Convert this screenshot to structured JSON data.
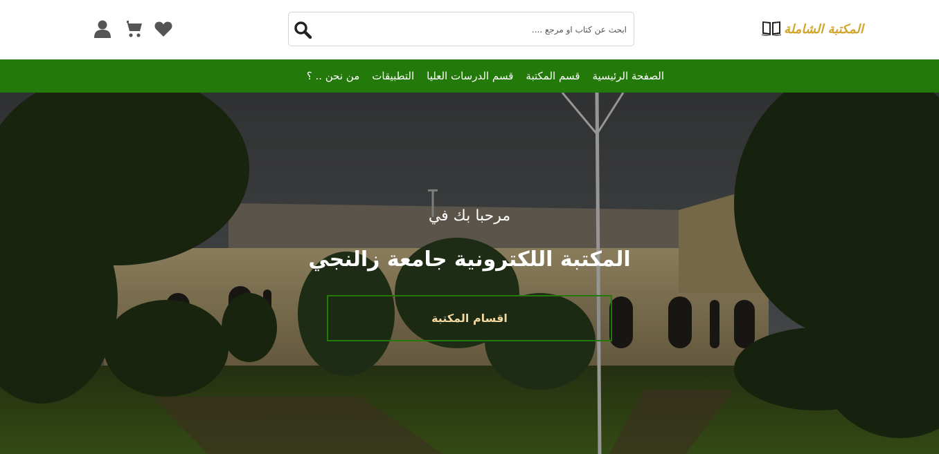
{
  "header": {
    "logo_text": "المكتبة الشاملة",
    "search": {
      "placeholder": "ابحث عن كتاب او مرجع ....",
      "value": ""
    },
    "icons": [
      "heart-icon",
      "cart-icon",
      "user-icon",
      "search-icon",
      "book-icon"
    ]
  },
  "nav": {
    "items": [
      {
        "label": "الصفحة الرئيسية"
      },
      {
        "label": "قسم المكتبة"
      },
      {
        "label": "قسم الدرسات العليا"
      },
      {
        "label": "التطبيقات"
      },
      {
        "label": "من نحن .. ؟"
      }
    ]
  },
  "hero": {
    "welcome": "مرحبا بك في",
    "title": "المكتبة اللكترونية جامعة زالنجي",
    "button_label": "اقسام المكتبة"
  },
  "colors": {
    "nav_background": "#237a0b",
    "logo_gold": "#d2a52c",
    "button_border": "#237a0b",
    "button_text": "#f3d8a2",
    "icon_gray": "#555555"
  }
}
